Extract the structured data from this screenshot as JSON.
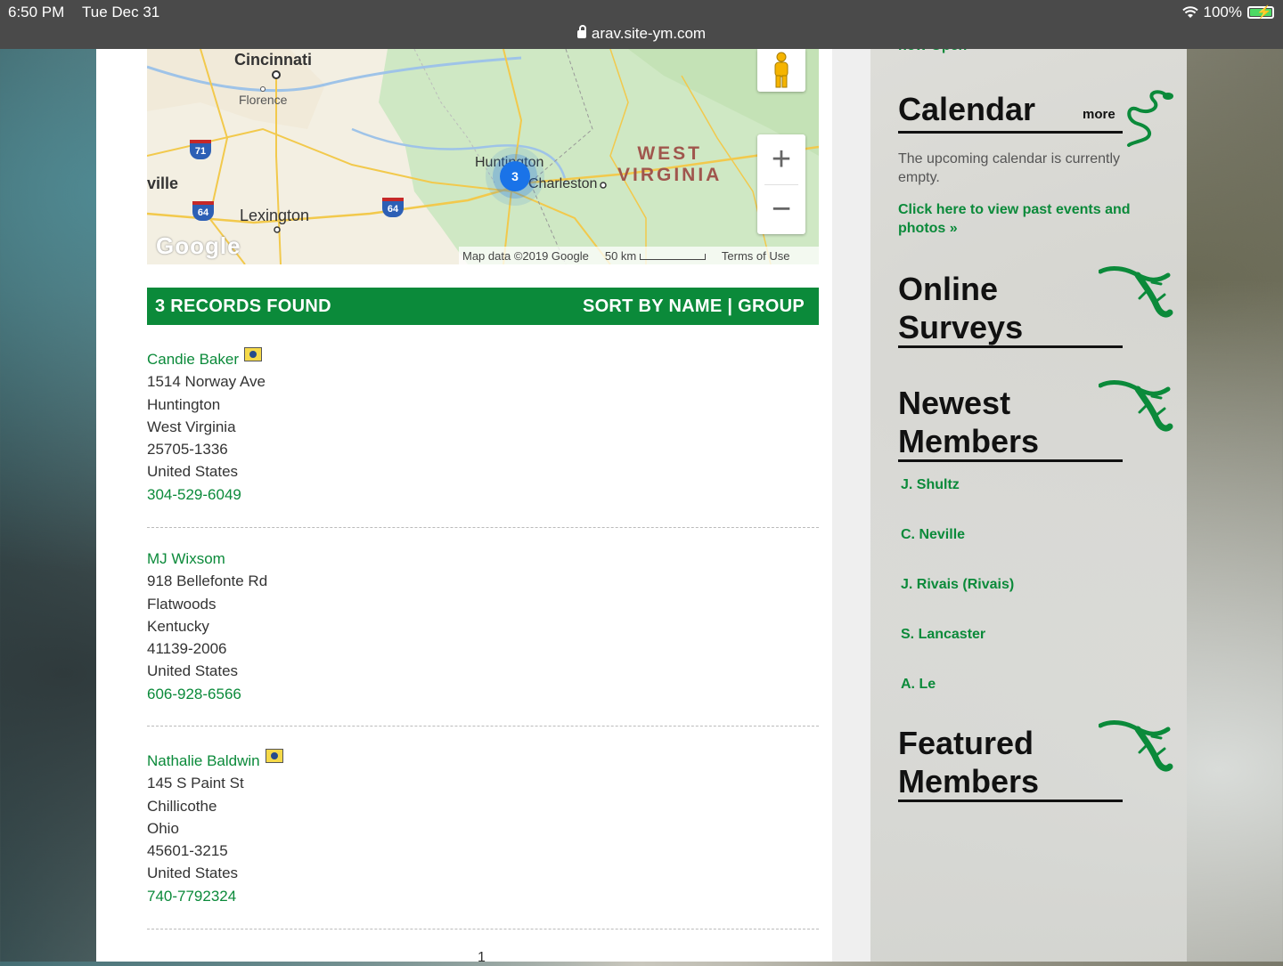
{
  "status_bar": {
    "time": "6:50 PM",
    "date": "Tue Dec 31",
    "url": "arav.site-ym.com",
    "battery": "100%"
  },
  "map": {
    "cities": {
      "cincinnati": "Cincinnati",
      "florence": "Florence",
      "lexington": "Lexington",
      "huntington": "Huntington",
      "charleston": "Charleston",
      "ville": "ville"
    },
    "state_line1": "WEST",
    "state_line2": "VIRGINIA",
    "cluster_count": "3",
    "highway_71": "71",
    "highway_64a": "64",
    "highway_64b": "64",
    "google_logo": "Google",
    "map_data": "Map data ©2019 Google",
    "scale": "50 km",
    "terms": "Terms of Use",
    "zoom_in": "+",
    "zoom_out": "−"
  },
  "records": {
    "count_label": "3 RECORDS FOUND",
    "sort_prefix": "SORT BY",
    "sort_name": "NAME",
    "sort_sep": "|",
    "sort_group": "GROUP",
    "items": [
      {
        "name": "Candie Baker",
        "street": "1514 Norway Ave",
        "city": "Huntington",
        "state": "West Virginia",
        "zip": "25705-1336",
        "country": "United States",
        "phone": "304-529-6049"
      },
      {
        "name": "MJ Wixsom",
        "street": "918 Bellefonte Rd",
        "city": "Flatwoods",
        "state": "Kentucky",
        "zip": "41139-2006",
        "country": "United States",
        "phone": "606-928-6566"
      },
      {
        "name": "Nathalie Baldwin",
        "street": "145 S Paint St",
        "city": "Chillicothe",
        "state": "Ohio",
        "zip": "45601-3215",
        "country": "United States",
        "phone": "740-7792324"
      }
    ],
    "page": "1"
  },
  "sidebar": {
    "now_open": "now Open",
    "calendar_title": "Calendar",
    "calendar_more": "more",
    "calendar_empty": "The upcoming calendar is currently empty.",
    "calendar_link": "Click here to view past events and photos »",
    "surveys_line1": "Online",
    "surveys_line2": "Surveys",
    "newest_line1": "Newest",
    "newest_line2": "Members",
    "newest_members": [
      "J. Shultz",
      "C. Neville",
      "J. Rivais (Rivais)",
      "S. Lancaster",
      "A. Le"
    ],
    "featured_line1": "Featured",
    "featured_line2": "Members"
  },
  "colors": {
    "brand_green": "#0b8a3a",
    "status_bar": "#4a4a4a"
  }
}
